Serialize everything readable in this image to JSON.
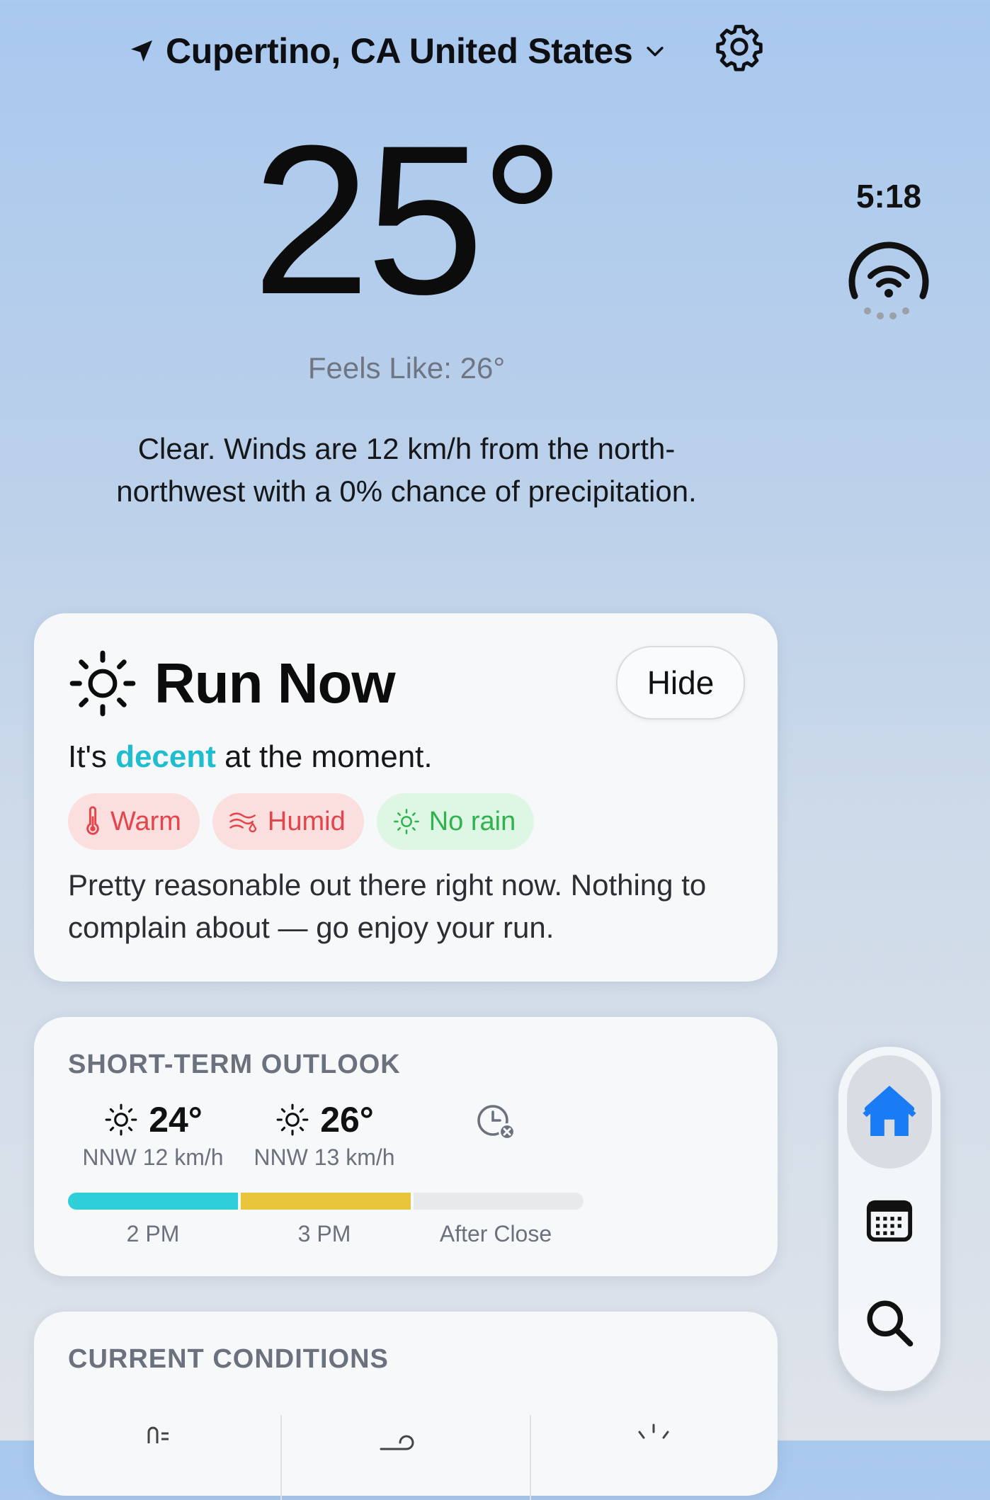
{
  "header": {
    "location": "Cupertino, CA United States",
    "icons": [
      "location-arrow-icon",
      "chevron-down-icon",
      "gear-icon"
    ]
  },
  "current": {
    "temperature": "25°",
    "feels_like": "Feels Like: 26°",
    "description": "Clear. Winds are 12 km/h from the north-northwest with a 0% chance of precipitation."
  },
  "status": {
    "time": "5:18",
    "icon": "wifi-icon"
  },
  "run_card": {
    "title": "Run Now",
    "hide_label": "Hide",
    "status_prefix": "It's ",
    "status_highlight": "decent",
    "status_suffix": " at the moment.",
    "highlight_color": "#1fbdd0",
    "chips": [
      {
        "label": "Warm",
        "icon": "thermometer-icon",
        "tone": "red"
      },
      {
        "label": "Humid",
        "icon": "humidity-icon",
        "tone": "red"
      },
      {
        "label": "No rain",
        "icon": "sun-icon",
        "tone": "green"
      }
    ],
    "body": "Pretty reasonable out there right now. Nothing to complain about — go enjoy your run."
  },
  "outlook": {
    "title": "SHORT-TERM OUTLOOK",
    "slots": [
      {
        "temp": "24°",
        "wind": "NNW 12 km/h",
        "time": "2 PM",
        "color": "#2ecfd9"
      },
      {
        "temp": "26°",
        "wind": "NNW 13 km/h",
        "time": "3 PM",
        "color": "#e8c53a"
      },
      {
        "temp": "",
        "wind": "",
        "time": "After Close",
        "color": "#e8e9eb",
        "icon": "clock-closed-icon"
      }
    ]
  },
  "conditions": {
    "title": "CURRENT CONDITIONS"
  },
  "nav": {
    "items": [
      "home-icon",
      "calendar-icon",
      "search-icon"
    ],
    "active": "home-icon",
    "active_color": "#1a7cf5"
  }
}
